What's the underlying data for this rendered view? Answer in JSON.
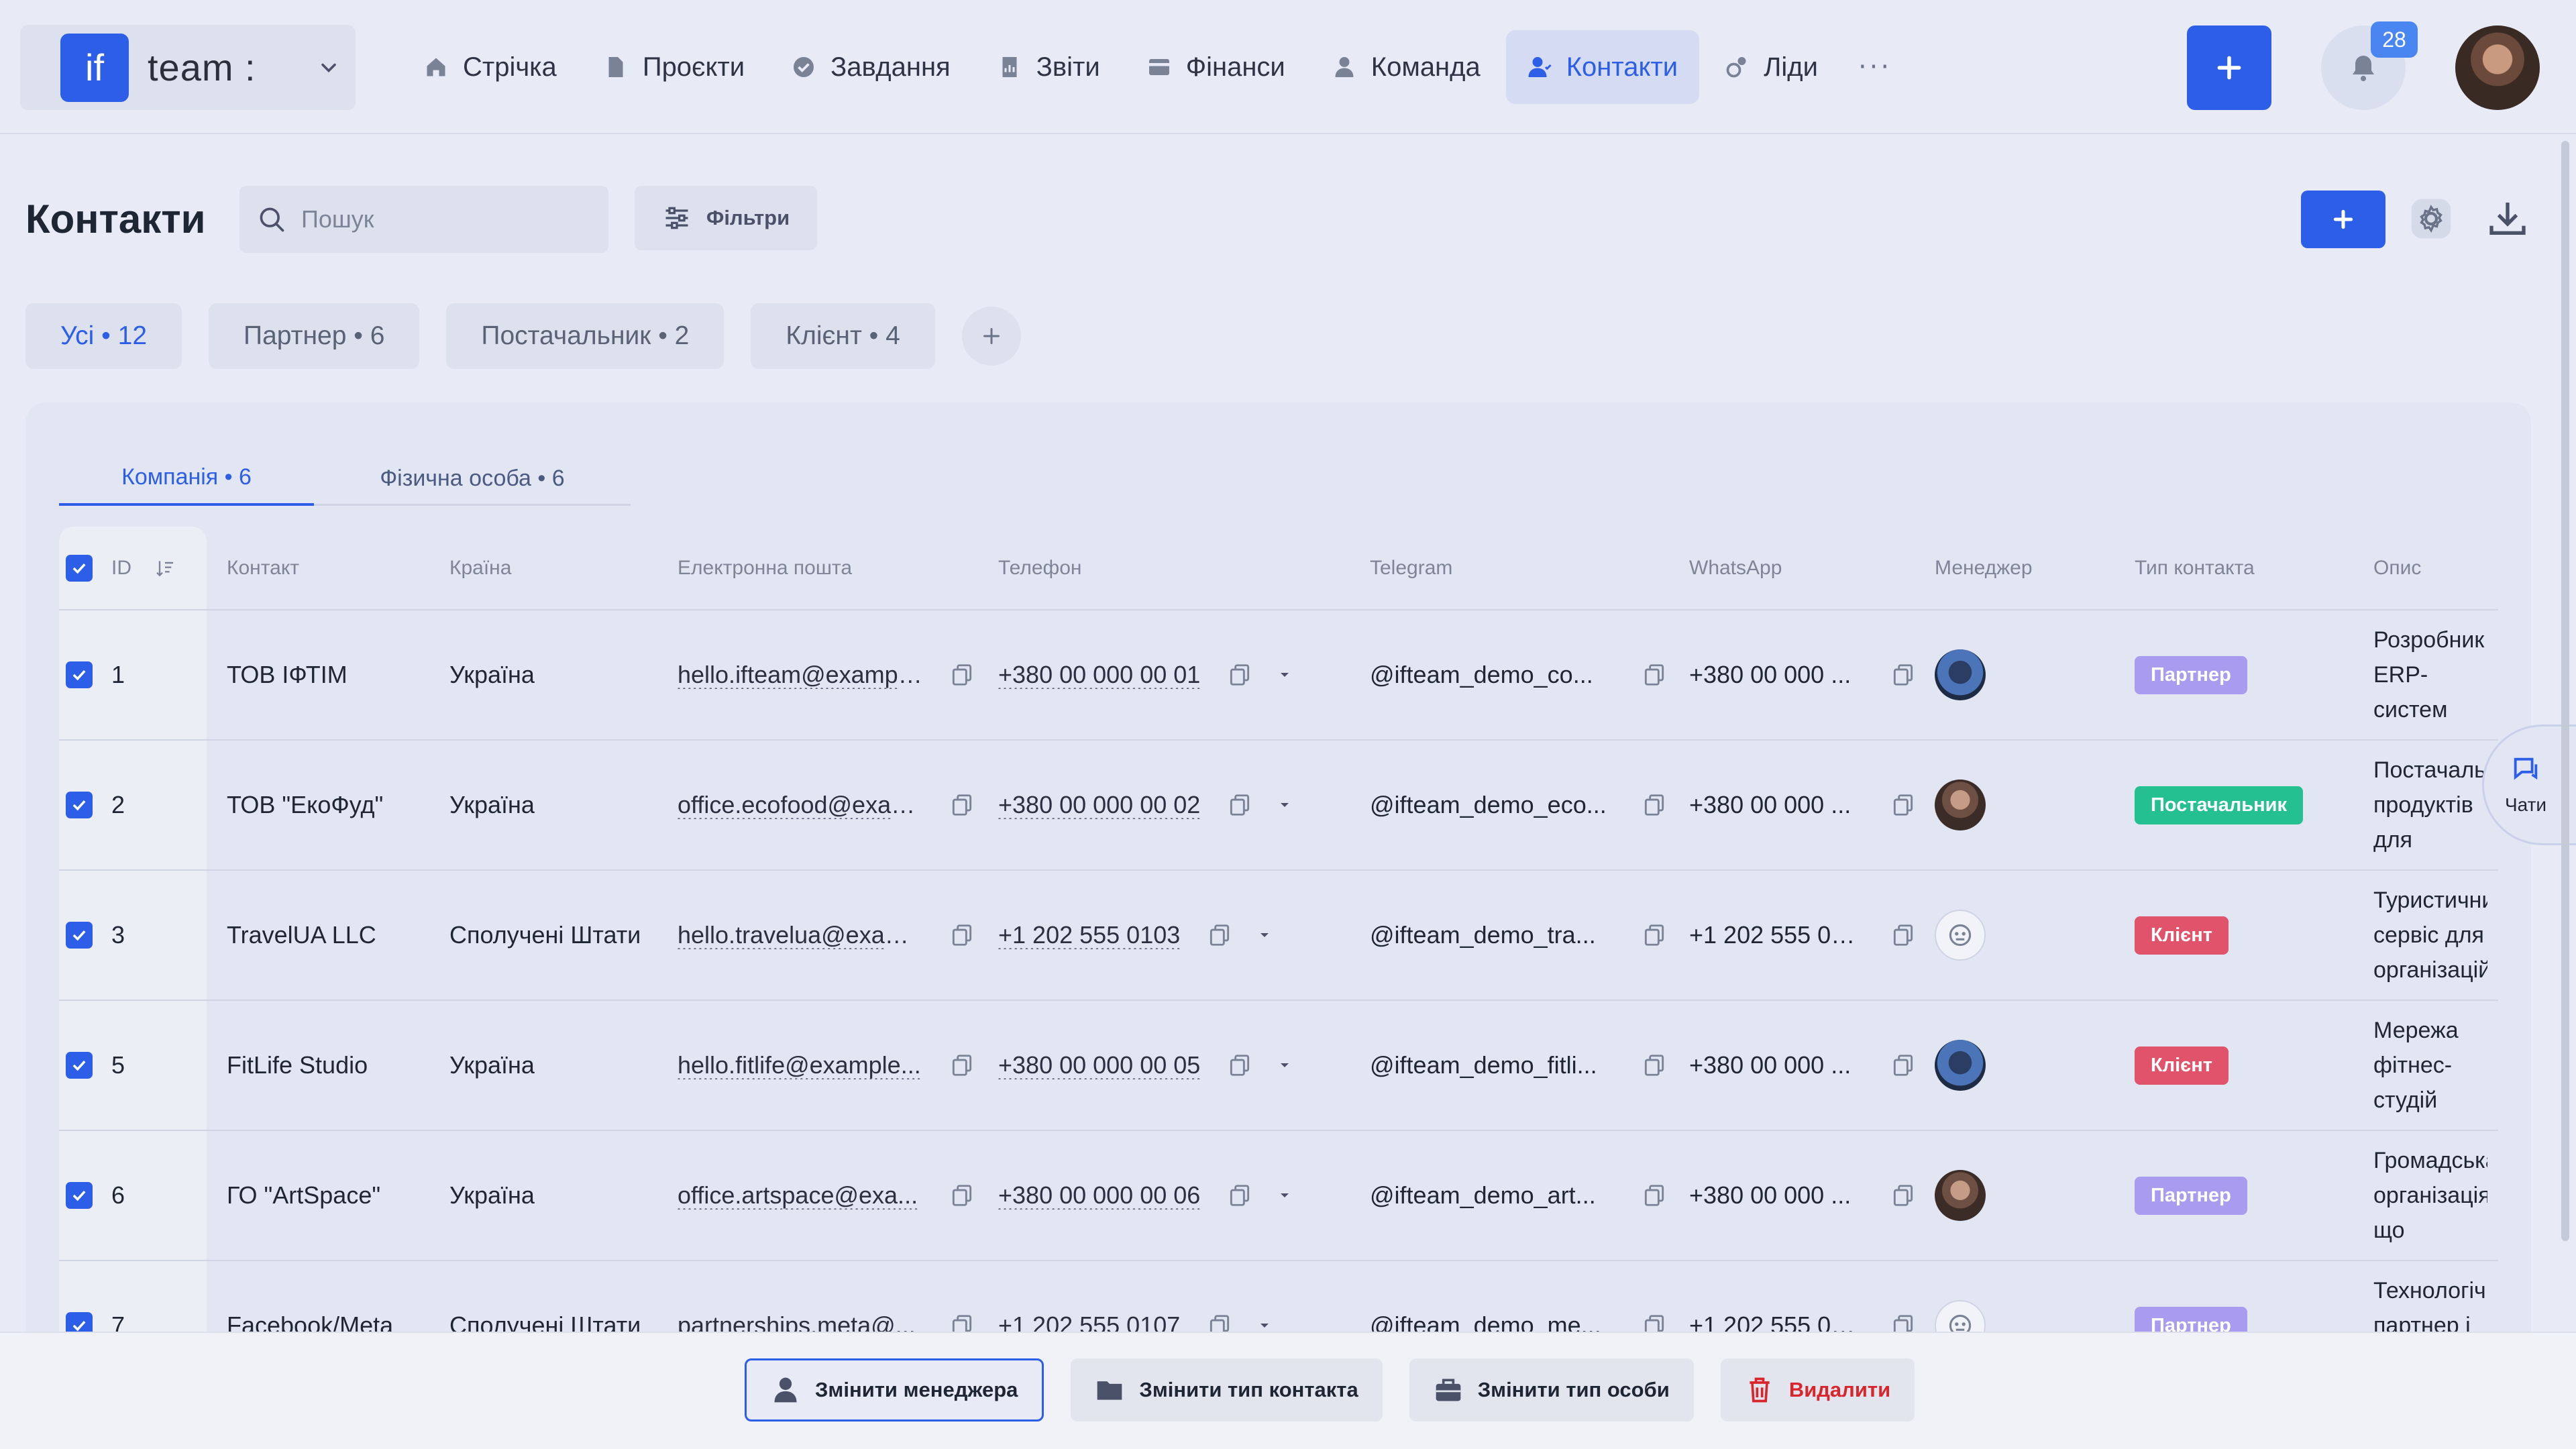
{
  "brand": {
    "logo": "if",
    "team_name": "team :"
  },
  "nav": [
    {
      "label": "Стрічка",
      "icon": "home-icon"
    },
    {
      "label": "Проєкти",
      "icon": "document-icon"
    },
    {
      "label": "Завдання",
      "icon": "check-circle-icon"
    },
    {
      "label": "Звіти",
      "icon": "report-icon"
    },
    {
      "label": "Фінанси",
      "icon": "wallet-icon"
    },
    {
      "label": "Команда",
      "icon": "user-icon"
    },
    {
      "label": "Контакти",
      "icon": "contacts-icon",
      "active": true
    },
    {
      "label": "Ліди",
      "icon": "leads-icon"
    }
  ],
  "nav_more": "···",
  "notifications": {
    "count": "28"
  },
  "page": {
    "title": "Контакти",
    "search_placeholder": "Пошук",
    "filters_label": "Фільтри"
  },
  "type_tabs": [
    {
      "label": "Усі • 12",
      "active": true
    },
    {
      "label": "Партнер • 6"
    },
    {
      "label": "Постачальник • 2"
    },
    {
      "label": "Клієнт • 4"
    }
  ],
  "subtabs": [
    {
      "label": "Компанія • 6",
      "active": true
    },
    {
      "label": "Фізична особа • 6"
    }
  ],
  "columns": {
    "id": "ID",
    "contact": "Контакт",
    "country": "Країна",
    "email": "Електронна пошта",
    "phone": "Телефон",
    "telegram": "Telegram",
    "whatsapp": "WhatsApp",
    "manager": "Менеджер",
    "type": "Тип контакта",
    "desc": "Опис"
  },
  "rows": [
    {
      "id": "1",
      "contact": "ТОВ ІФТІМ",
      "country": "Україна",
      "email": "hello.ifteam@exampl...",
      "phone": "+380 00 000 00 01",
      "telegram": "@ifteam_demo_co...",
      "whatsapp": "+380 00 000 ...",
      "manager": "av-a",
      "type": "Партнер",
      "type_color": "#a99cf0",
      "desc": "Розробник ERP-систем для..."
    },
    {
      "id": "2",
      "contact": "ТОВ \"ЕкоФуд\"",
      "country": "Україна",
      "email": "office.ecofood@exam...",
      "phone": "+380 00 000 00 02",
      "telegram": "@ifteam_demo_eco...",
      "whatsapp": "+380 00 000 ...",
      "manager": "av-b",
      "type": "Постачальник",
      "type_color": "#24c08f",
      "desc": "Постачальник продуктів для корпоративних..."
    },
    {
      "id": "3",
      "contact": "TravelUA LLC",
      "country": "Сполучені Штати",
      "email": "hello.travelua@exam...",
      "phone": "+1 202 555 0103",
      "telegram": "@ifteam_demo_tra...",
      "whatsapp": "+1 202 555 01...",
      "manager": "av-c",
      "type": "Клієнт",
      "type_color": "#e0536b",
      "desc": "Туристичний сервіс для організацій"
    },
    {
      "id": "5",
      "contact": "FitLife Studio",
      "country": "Україна",
      "email": "hello.fitlife@example...",
      "phone": "+380 00 000 00 05",
      "telegram": "@ifteam_demo_fitli...",
      "whatsapp": "+380 00 000 ...",
      "manager": "av-a",
      "type": "Клієнт",
      "type_color": "#e0536b",
      "desc": "Мережа фітнес-студій замовник"
    },
    {
      "id": "6",
      "contact": "ГО \"ArtSpace\"",
      "country": "Україна",
      "email": "office.artspace@exa...",
      "phone": "+380 00 000 00 06",
      "telegram": "@ifteam_demo_art...",
      "whatsapp": "+380 00 000 ...",
      "manager": "av-b",
      "type": "Партнер",
      "type_color": "#a99cf0",
      "desc": "Громадська організація, що реалізує"
    },
    {
      "id": "7",
      "contact": "Facebook/Meta",
      "country": "Сполучені Штати",
      "email": "partnerships.meta@...",
      "phone": "+1 202 555 0107",
      "telegram": "@ifteam_demo_me...",
      "whatsapp": "+1 202 555 01...",
      "manager": "av-c",
      "type": "Партнер",
      "type_color": "#a99cf0",
      "desc": "Технологічний партнер і"
    }
  ],
  "chat": {
    "label": "Чати"
  },
  "actions": [
    {
      "label": "Змінити менеджера",
      "icon": "user-icon",
      "style": "outlined"
    },
    {
      "label": "Змінити тип контакта",
      "icon": "folder-icon"
    },
    {
      "label": "Змінити тип особи",
      "icon": "briefcase-icon"
    },
    {
      "label": "Видалити",
      "icon": "trash-icon",
      "style": "danger"
    }
  ],
  "colors": {
    "accent": "#2c5ee8",
    "partner": "#a99cf0",
    "supplier": "#24c08f",
    "client": "#e0536b",
    "danger": "#d9262c"
  }
}
